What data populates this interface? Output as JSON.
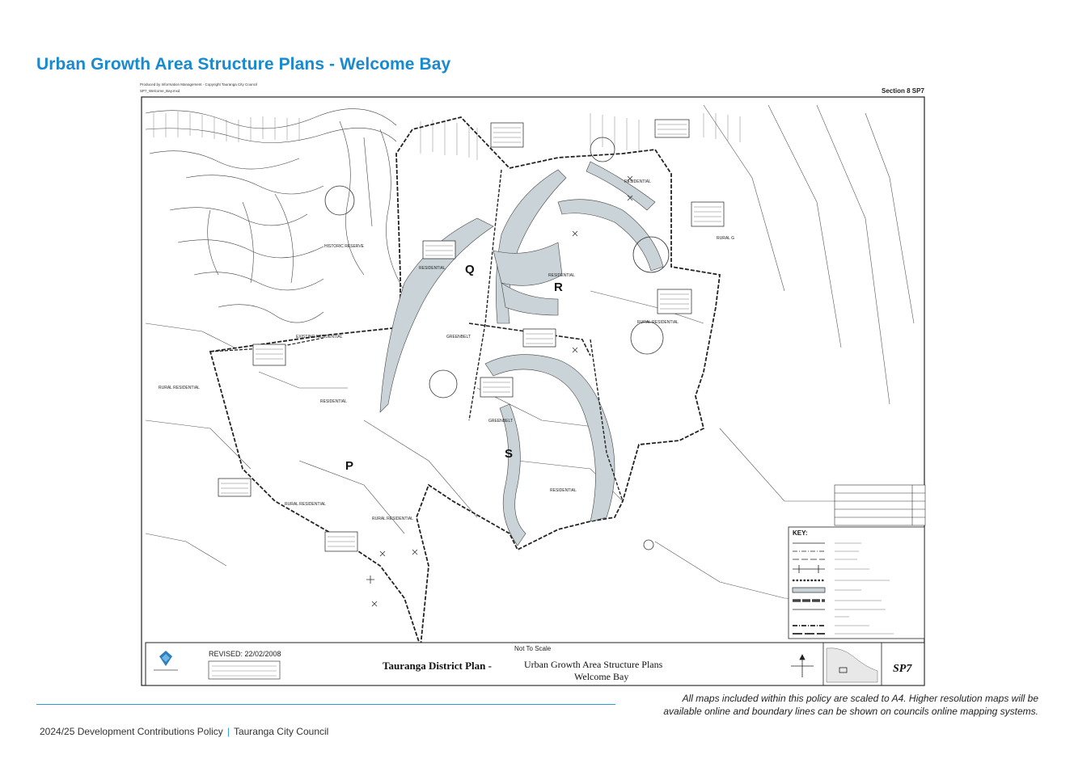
{
  "page": {
    "title": "Urban Growth Area Structure Plans - Welcome Bay",
    "note_line1": "All maps included within this policy are scaled to A4. Higher resolution maps will be",
    "note_line2": "available online and boundary lines can be shown on councils online mapping systems.",
    "footer_policy": "2024/25 Development Contributions Policy",
    "footer_separator": "|",
    "footer_council": "Tauranga City Council"
  },
  "map": {
    "section": "Section 8 SP7",
    "zones": [
      "Q",
      "R",
      "S",
      "P"
    ],
    "labels": {
      "residential": "RESIDENTIAL",
      "rural_residential": "RURAL RESIDENTIAL",
      "greenbelt": "GREENBELT",
      "historic_reserve": "HISTORIC RESERVE",
      "existing_residential": "EXISTING RESIDENTIAL",
      "rural_g": "RURAL G",
      "rural_residential_2": "RURAL RESIDENTIAL"
    },
    "key": {
      "title": "KEY:"
    },
    "title_block": {
      "revised": "REVISED: 22/02/2008",
      "not_to_scale": "Not To Scale",
      "plan_name_bold": "Tauranga District Plan -",
      "plan_name_rest": "Urban Growth Area Structure Plans",
      "plan_subtitle": "Welcome Bay",
      "sheet": "SP7"
    },
    "colors": {
      "title_blue": "#1a8ad0",
      "greenbelt_fill": "#c9d3d8",
      "line": "#222222"
    }
  }
}
